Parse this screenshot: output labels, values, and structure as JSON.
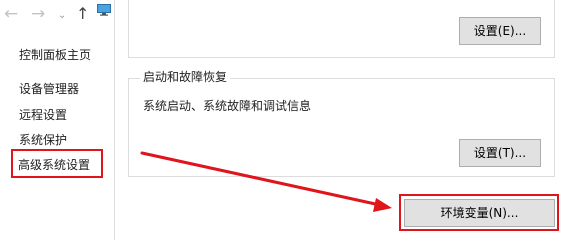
{
  "nav": {
    "back_glyph": "←",
    "forward_glyph": "→",
    "recent_glyph": "⌄",
    "up_glyph": "↑",
    "computer_icon": "computer-icon"
  },
  "sidebar": {
    "home": "控制面板主页",
    "items": [
      {
        "label": "设备管理器"
      },
      {
        "label": "远程设置"
      },
      {
        "label": "系统保护"
      },
      {
        "label": "高级系统设置"
      }
    ]
  },
  "groups": {
    "top": {
      "button_label": "设置(E)..."
    },
    "recovery": {
      "title": "启动和故障恢复",
      "description": "系统启动、系统故障和调试信息",
      "button_label": "设置(T)..."
    }
  },
  "env_button_label": "环境变量(N)...",
  "colors": {
    "highlight": "#e0141b",
    "button_bg": "#e1e1e1",
    "button_border": "#adadad",
    "divider": "#dcdcdc"
  }
}
